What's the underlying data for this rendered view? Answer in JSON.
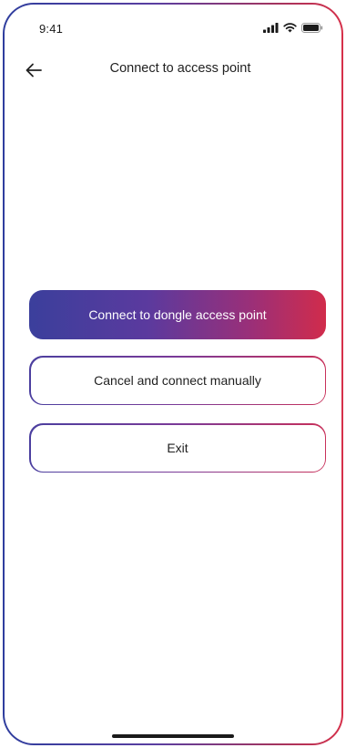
{
  "status_bar": {
    "time": "9:41",
    "icons": [
      "signal-icon",
      "wifi-icon",
      "battery-icon"
    ]
  },
  "header": {
    "back_icon": "arrow-left-icon",
    "title": "Connect to access point"
  },
  "actions": {
    "primary_label": "Connect to dongle access point",
    "cancel_label": "Cancel and connect manually",
    "exit_label": "Exit"
  },
  "colors": {
    "gradient_start": "#3b3f9c",
    "gradient_mid": "#5b3a9e",
    "gradient_end": "#d12c4b",
    "text_dark": "#1f1f1f",
    "background": "#ffffff"
  }
}
